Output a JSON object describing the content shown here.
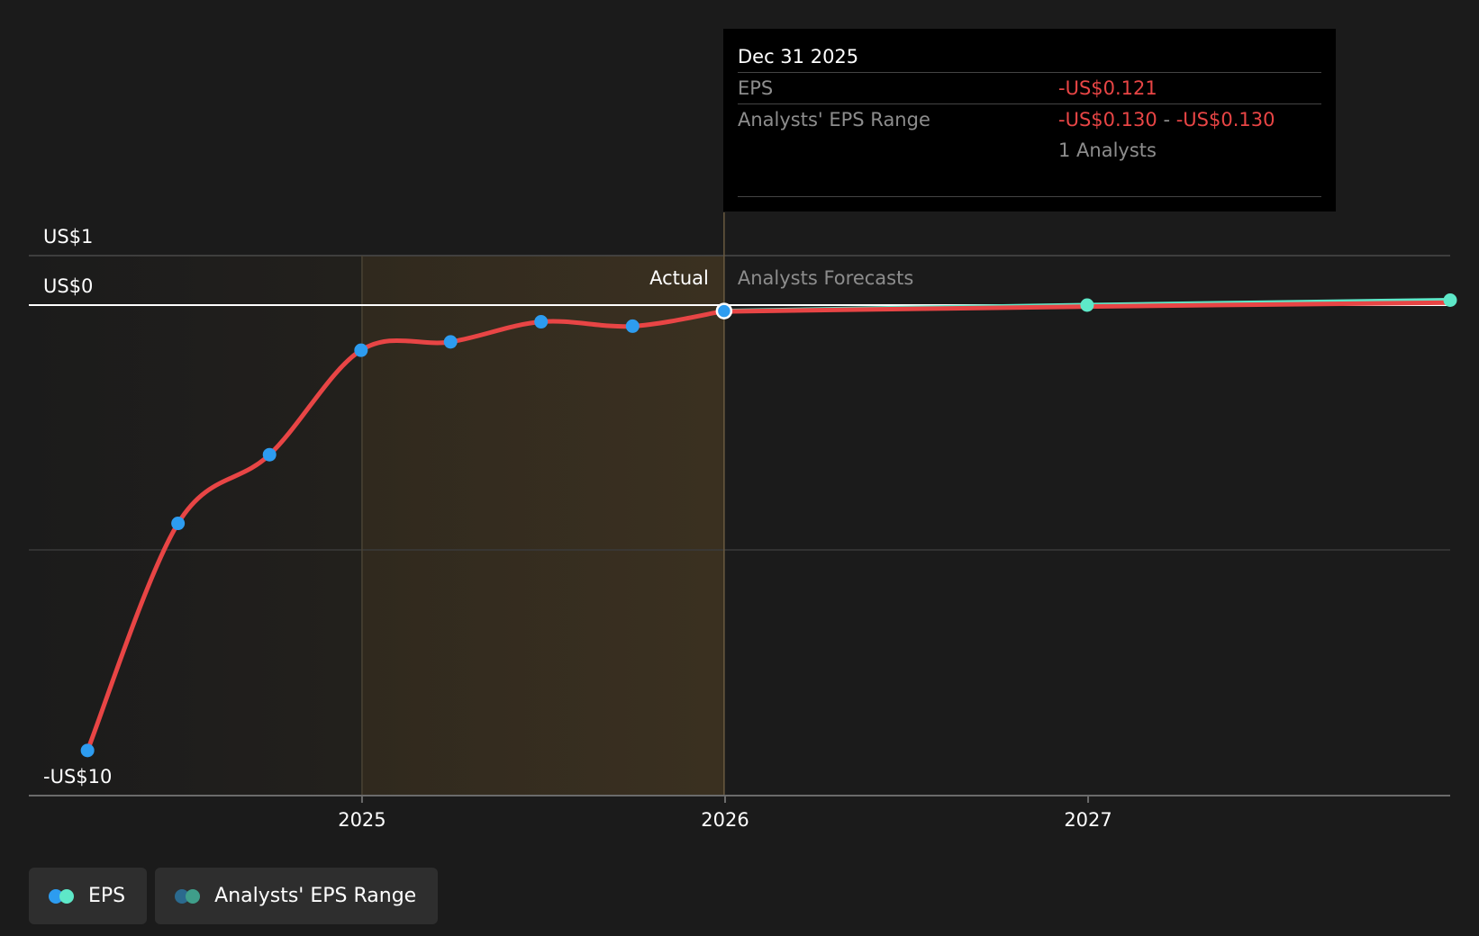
{
  "colors": {
    "background": "#1b1b1b",
    "eps_line": "#e84545",
    "eps_point": "#2d9cf0",
    "forecast_line": "#5ee8c8",
    "forecast_point": "#5ee8c8",
    "range_point_1": "#2b6a8e",
    "range_point_2": "#3f9e8a",
    "actual_region": "#3a3020",
    "grid": "#3a3a3a",
    "zero_line": "#ffffff"
  },
  "chart_data": {
    "type": "line",
    "y_ticks": [
      {
        "label": "US$1",
        "value": 1
      },
      {
        "label": "US$0",
        "value": 0
      },
      {
        "label": "-US$10",
        "value": -10
      }
    ],
    "x_ticks": [
      {
        "label": "2025",
        "value": "2025-01-01"
      },
      {
        "label": "2026",
        "value": "2026-01-01"
      },
      {
        "label": "2027",
        "value": "2027-01-01"
      }
    ],
    "xlim": [
      "2024-02-01",
      "2027-12-31"
    ],
    "actual_label": "Actual",
    "forecast_label": "Analysts Forecasts",
    "actual_region": [
      "2024-02-01",
      "2025-12-31"
    ],
    "highlight_region": [
      "2025-01-01",
      "2025-12-31"
    ],
    "series": [
      {
        "name": "EPS",
        "role": "actual",
        "points": [
          {
            "x": "2024-03-31",
            "y": -9.08
          },
          {
            "x": "2024-06-30",
            "y": -4.45
          },
          {
            "x": "2024-09-30",
            "y": -3.05
          },
          {
            "x": "2024-12-31",
            "y": -0.92
          },
          {
            "x": "2025-03-31",
            "y": -0.75
          },
          {
            "x": "2025-06-30",
            "y": -0.34
          },
          {
            "x": "2025-09-30",
            "y": -0.43
          },
          {
            "x": "2025-12-31",
            "y": -0.121
          }
        ]
      },
      {
        "name": "EPS",
        "role": "forecast",
        "points": [
          {
            "x": "2025-12-31",
            "y": -0.121
          },
          {
            "x": "2026-12-31",
            "y": 0.0
          },
          {
            "x": "2027-12-31",
            "y": 0.1
          }
        ]
      },
      {
        "name": "Analysts' EPS Range",
        "role": "range",
        "points": [
          {
            "x": "2025-12-31",
            "y": -0.13
          },
          {
            "x": "2026-12-31",
            "y": -0.03
          },
          {
            "x": "2027-12-31",
            "y": 0.05
          }
        ]
      }
    ]
  },
  "tooltip": {
    "date": "Dec 31 2025",
    "eps_label": "EPS",
    "eps_value": "-US$0.121",
    "range_label": "Analysts' EPS Range",
    "range_low": "-US$0.130",
    "range_sep": "-",
    "range_high": "-US$0.130",
    "analysts": "1 Analysts"
  },
  "legend": {
    "eps_label": "EPS",
    "range_label": "Analysts' EPS Range"
  }
}
